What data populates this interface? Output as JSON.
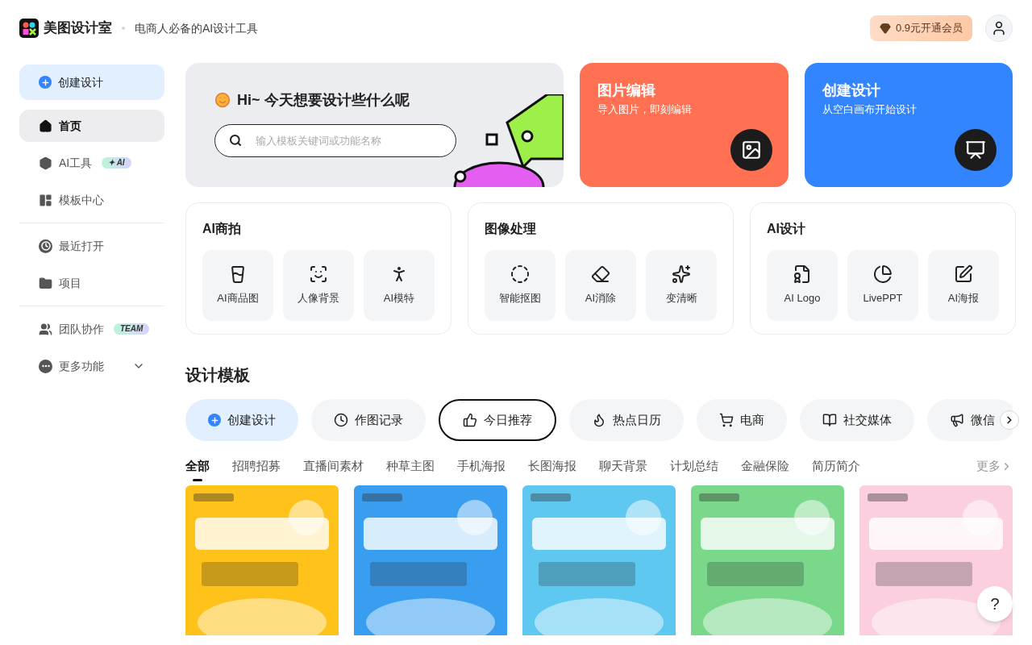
{
  "header": {
    "brand": "美图设计室",
    "tagline": "电商人必备的AI设计工具",
    "vip_button": "0.9元开通会员"
  },
  "sidebar": {
    "create_button": "创建设计",
    "groups": [
      [
        {
          "label": "首页",
          "selected": true
        },
        {
          "label": "AI工具",
          "badge": "✦ AI",
          "selected": false
        },
        {
          "label": "模板中心",
          "selected": false
        }
      ],
      [
        {
          "label": "最近打开",
          "selected": false
        },
        {
          "label": "项目",
          "selected": false
        }
      ],
      [
        {
          "label": "团队协作",
          "badge": "TEAM",
          "selected": false
        },
        {
          "label": "更多功能",
          "selected": false
        }
      ]
    ]
  },
  "hero": {
    "greeting": "Hi~ 今天想要设计些什么呢",
    "search": {
      "placeholder": "输入模板关键词或功能名称"
    }
  },
  "feature_cards": [
    {
      "title": "图片编辑",
      "subtitle": "导入图片，即刻编辑"
    },
    {
      "title": "创建设计",
      "subtitle": "从空白画布开始设计"
    }
  ],
  "tool_groups": [
    {
      "title": "AI商拍",
      "tools": [
        {
          "label": "AI商品图"
        },
        {
          "label": "人像背景"
        },
        {
          "label": "AI模特"
        }
      ]
    },
    {
      "title": "图像处理",
      "tools": [
        {
          "label": "智能抠图"
        },
        {
          "label": "AI消除"
        },
        {
          "label": "变清晰"
        }
      ]
    },
    {
      "title": "AI设计",
      "tools": [
        {
          "label": "AI Logo"
        },
        {
          "label": "LivePPT"
        },
        {
          "label": "AI海报"
        }
      ]
    }
  ],
  "templates": {
    "title": "设计模板",
    "chips": [
      {
        "label": "创建设计",
        "selected": false
      },
      {
        "label": "作图记录",
        "selected": false
      },
      {
        "label": "今日推荐",
        "selected": true
      },
      {
        "label": "热点日历",
        "selected": false
      },
      {
        "label": "电商",
        "selected": false
      },
      {
        "label": "社交媒体",
        "selected": false
      },
      {
        "label": "微信",
        "selected": false
      }
    ],
    "categories": [
      {
        "label": "全部",
        "selected": true
      },
      {
        "label": "招聘招募",
        "selected": false
      },
      {
        "label": "直播间素材",
        "selected": false
      },
      {
        "label": "种草主图",
        "selected": false
      },
      {
        "label": "手机海报",
        "selected": false
      },
      {
        "label": "长图海报",
        "selected": false
      },
      {
        "label": "聊天背景",
        "selected": false
      },
      {
        "label": "计划总结",
        "selected": false
      },
      {
        "label": "金融保险",
        "selected": false
      },
      {
        "label": "简历简介",
        "selected": false
      }
    ],
    "more_link": "更多"
  },
  "help_button": "?"
}
